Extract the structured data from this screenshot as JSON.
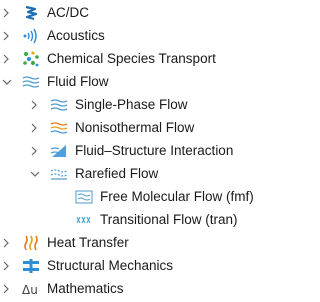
{
  "tree": {
    "items": [
      {
        "label": "AC/DC",
        "icon": "acdc-icon",
        "expanded": false
      },
      {
        "label": "Acoustics",
        "icon": "acoustics-icon",
        "expanded": false
      },
      {
        "label": "Chemical Species Transport",
        "icon": "chemical-species-icon",
        "expanded": false
      },
      {
        "label": "Fluid Flow",
        "icon": "fluid-flow-icon",
        "expanded": true,
        "children": [
          {
            "label": "Single-Phase Flow",
            "icon": "single-phase-flow-icon",
            "expanded": false
          },
          {
            "label": "Nonisothermal Flow",
            "icon": "nonisothermal-flow-icon",
            "expanded": false
          },
          {
            "label": "Fluid–Structure Interaction",
            "icon": "fsi-icon",
            "expanded": false
          },
          {
            "label": "Rarefied Flow",
            "icon": "rarefied-flow-icon",
            "expanded": true,
            "children": [
              {
                "label": "Free Molecular Flow (fmf)",
                "icon": "free-molecular-flow-icon"
              },
              {
                "label": "Transitional Flow (tran)",
                "icon": "transitional-flow-icon"
              }
            ]
          }
        ]
      },
      {
        "label": "Heat Transfer",
        "icon": "heat-transfer-icon",
        "expanded": false
      },
      {
        "label": "Structural Mechanics",
        "icon": "structural-mechanics-icon",
        "expanded": false
      },
      {
        "label": "Mathematics",
        "icon": "mathematics-icon",
        "expanded": false
      }
    ]
  },
  "colors": {
    "acdc": "#1a6fb5",
    "acoustics": "#2a8de0",
    "chemical": "#3aa845",
    "fluid": "#4c9ad0",
    "heat": "#e07a1a",
    "structural": "#2f8ed8"
  }
}
